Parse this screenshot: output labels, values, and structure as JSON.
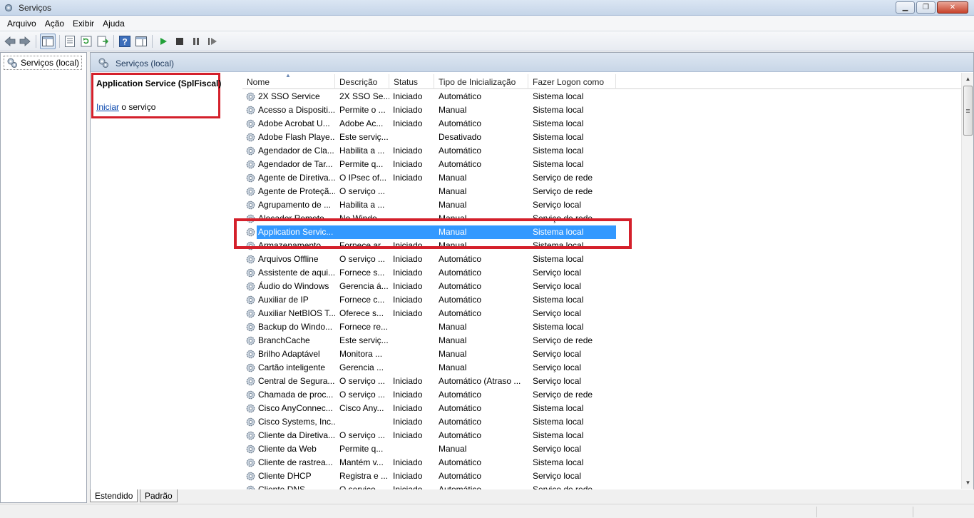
{
  "window": {
    "title": "Serviços"
  },
  "window_buttons": {
    "minimize": "▁",
    "restore": "❐",
    "close": "✕"
  },
  "menu": [
    "Arquivo",
    "Ação",
    "Exibir",
    "Ajuda"
  ],
  "tree": {
    "root_label": "Serviços (local)"
  },
  "pane": {
    "header_title": "Serviços (local)"
  },
  "details": {
    "service_title": "Application Service (SplFiscal)",
    "action_link": "Iniciar",
    "action_suffix": " o serviço"
  },
  "columns": [
    "Nome",
    "Descrição",
    "Status",
    "Tipo de Inicialização",
    "Fazer Logon como"
  ],
  "selected_row_index": 10,
  "rows": [
    {
      "name": "2X SSO Service",
      "desc": "2X SSO Se...",
      "status": "Iniciado",
      "startup": "Automático",
      "logon": "Sistema local"
    },
    {
      "name": "Acesso a Dispositi...",
      "desc": "Permite o ...",
      "status": "Iniciado",
      "startup": "Manual",
      "logon": "Sistema local"
    },
    {
      "name": "Adobe Acrobat U...",
      "desc": "Adobe Ac...",
      "status": "Iniciado",
      "startup": "Automático",
      "logon": "Sistema local"
    },
    {
      "name": "Adobe Flash Playe...",
      "desc": "Este serviç...",
      "status": "",
      "startup": "Desativado",
      "logon": "Sistema local"
    },
    {
      "name": "Agendador de Cla...",
      "desc": "Habilita a ...",
      "status": "Iniciado",
      "startup": "Automático",
      "logon": "Sistema local"
    },
    {
      "name": "Agendador de Tar...",
      "desc": "Permite q...",
      "status": "Iniciado",
      "startup": "Automático",
      "logon": "Sistema local"
    },
    {
      "name": "Agente de Diretiva...",
      "desc": "O IPsec of...",
      "status": "Iniciado",
      "startup": "Manual",
      "logon": "Serviço de rede"
    },
    {
      "name": "Agente de Proteçã...",
      "desc": "O serviço ...",
      "status": "",
      "startup": "Manual",
      "logon": "Serviço de rede"
    },
    {
      "name": "Agrupamento de ...",
      "desc": "Habilita a ...",
      "status": "",
      "startup": "Manual",
      "logon": "Serviço local"
    },
    {
      "name": "Alocador Remoto...",
      "desc": "No Windo...",
      "status": "",
      "startup": "Manual",
      "logon": "Serviço de rede"
    },
    {
      "name": "Application Servic...",
      "desc": "",
      "status": "",
      "startup": "Manual",
      "logon": "Sistema local"
    },
    {
      "name": "Armazenamento ...",
      "desc": "Fornece ar...",
      "status": "Iniciado",
      "startup": "Manual",
      "logon": "Sistema local"
    },
    {
      "name": "Arquivos Offline",
      "desc": "O serviço ...",
      "status": "Iniciado",
      "startup": "Automático",
      "logon": "Sistema local"
    },
    {
      "name": "Assistente de aqui...",
      "desc": "Fornece s...",
      "status": "Iniciado",
      "startup": "Automático",
      "logon": "Serviço local"
    },
    {
      "name": "Áudio do Windows",
      "desc": "Gerencia á...",
      "status": "Iniciado",
      "startup": "Automático",
      "logon": "Serviço local"
    },
    {
      "name": "Auxiliar de IP",
      "desc": "Fornece c...",
      "status": "Iniciado",
      "startup": "Automático",
      "logon": "Sistema local"
    },
    {
      "name": "Auxiliar NetBIOS T...",
      "desc": "Oferece s...",
      "status": "Iniciado",
      "startup": "Automático",
      "logon": "Serviço local"
    },
    {
      "name": "Backup do Windo...",
      "desc": "Fornece re...",
      "status": "",
      "startup": "Manual",
      "logon": "Sistema local"
    },
    {
      "name": "BranchCache",
      "desc": "Este serviç...",
      "status": "",
      "startup": "Manual",
      "logon": "Serviço de rede"
    },
    {
      "name": "Brilho Adaptável",
      "desc": "Monitora ...",
      "status": "",
      "startup": "Manual",
      "logon": "Serviço local"
    },
    {
      "name": "Cartão inteligente",
      "desc": "Gerencia ...",
      "status": "",
      "startup": "Manual",
      "logon": "Serviço local"
    },
    {
      "name": "Central de Segura...",
      "desc": "O serviço ...",
      "status": "Iniciado",
      "startup": "Automático (Atraso ...",
      "logon": "Serviço local"
    },
    {
      "name": "Chamada de proc...",
      "desc": "O serviço ...",
      "status": "Iniciado",
      "startup": "Automático",
      "logon": "Serviço de rede"
    },
    {
      "name": "Cisco AnyConnec...",
      "desc": "Cisco Any...",
      "status": "Iniciado",
      "startup": "Automático",
      "logon": "Sistema local"
    },
    {
      "name": "Cisco Systems, Inc...",
      "desc": "",
      "status": "Iniciado",
      "startup": "Automático",
      "logon": "Sistema local"
    },
    {
      "name": "Cliente da Diretiva...",
      "desc": "O serviço ...",
      "status": "Iniciado",
      "startup": "Automático",
      "logon": "Sistema local"
    },
    {
      "name": "Cliente da Web",
      "desc": "Permite q...",
      "status": "",
      "startup": "Manual",
      "logon": "Serviço local"
    },
    {
      "name": "Cliente de rastrea...",
      "desc": "Mantém v...",
      "status": "Iniciado",
      "startup": "Automático",
      "logon": "Sistema local"
    },
    {
      "name": "Cliente DHCP",
      "desc": "Registra e ...",
      "status": "Iniciado",
      "startup": "Automático",
      "logon": "Serviço local"
    },
    {
      "name": "Cliente DNS",
      "desc": "O serviço ...",
      "status": "Iniciado",
      "startup": "Automático",
      "logon": "Serviço de rede"
    }
  ],
  "tabs": [
    "Estendido",
    "Padrão"
  ],
  "toolbar_icons": [
    "back-icon",
    "forward-icon",
    "show-hide-tree-icon",
    "properties-icon",
    "refresh-icon",
    "export-list-icon",
    "help-icon",
    "action-pane-icon",
    "start-service-icon",
    "stop-service-icon",
    "pause-service-icon",
    "restart-service-icon"
  ]
}
